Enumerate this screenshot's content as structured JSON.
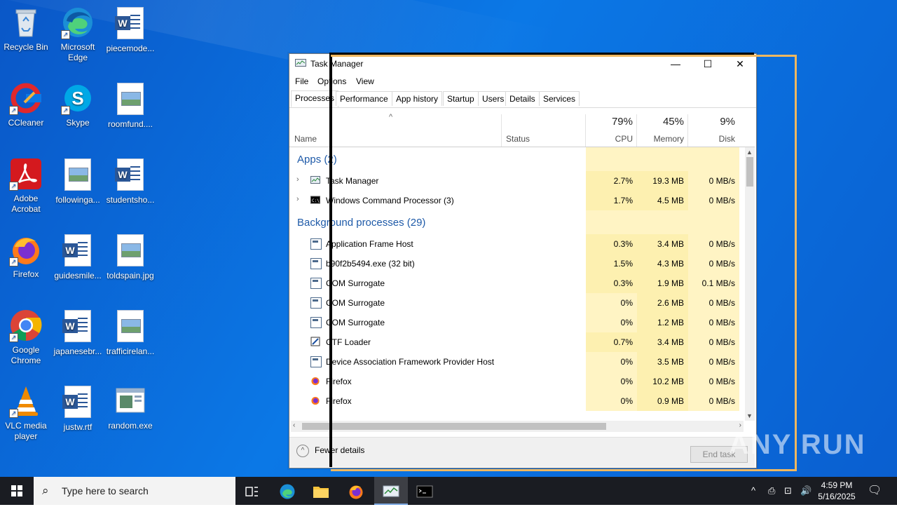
{
  "desktop": {
    "icons": [
      {
        "label": "Recycle Bin"
      },
      {
        "label": "Microsoft Edge"
      },
      {
        "label": "piecemode..."
      },
      {
        "label": "CCleaner"
      },
      {
        "label": "Skype"
      },
      {
        "label": "roomfund...."
      },
      {
        "label": "Adobe Acrobat"
      },
      {
        "label": "followinga..."
      },
      {
        "label": "studentsho..."
      },
      {
        "label": "Firefox"
      },
      {
        "label": "guidesmile..."
      },
      {
        "label": "toldspain.jpg"
      },
      {
        "label": "Google Chrome"
      },
      {
        "label": "japanesebr..."
      },
      {
        "label": "trafficirelan..."
      },
      {
        "label": "VLC media player"
      },
      {
        "label": "justw.rtf"
      },
      {
        "label": "random.exe"
      }
    ]
  },
  "window": {
    "title": "Task Manager",
    "menu": [
      "File",
      "Options",
      "View"
    ],
    "tabs": [
      "Processes",
      "Performance",
      "App history",
      "Startup",
      "Users",
      "Details",
      "Services"
    ],
    "columns": {
      "name": "Name",
      "status": "Status",
      "cpu_pct": "79%",
      "cpu": "CPU",
      "mem_pct": "45%",
      "mem": "Memory",
      "disk_pct": "9%",
      "disk": "Disk"
    },
    "groups": {
      "apps": "Apps (2)",
      "background": "Background processes (29)"
    },
    "apps": [
      {
        "name": "Task Manager",
        "cpu": "2.7%",
        "mem": "19.3 MB",
        "disk": "0 MB/s"
      },
      {
        "name": "Windows Command Processor (3)",
        "cpu": "1.7%",
        "mem": "4.5 MB",
        "disk": "0 MB/s"
      }
    ],
    "background": [
      {
        "name": "Application Frame Host",
        "cpu": "0.3%",
        "mem": "3.4 MB",
        "disk": "0 MB/s"
      },
      {
        "name": "b90f2b5494.exe (32 bit)",
        "cpu": "1.5%",
        "mem": "4.3 MB",
        "disk": "0 MB/s"
      },
      {
        "name": "COM Surrogate",
        "cpu": "0.3%",
        "mem": "1.9 MB",
        "disk": "0.1 MB/s"
      },
      {
        "name": "COM Surrogate",
        "cpu": "0%",
        "mem": "2.6 MB",
        "disk": "0 MB/s"
      },
      {
        "name": "COM Surrogate",
        "cpu": "0%",
        "mem": "1.2 MB",
        "disk": "0 MB/s"
      },
      {
        "name": "CTF Loader",
        "cpu": "0.7%",
        "mem": "3.4 MB",
        "disk": "0 MB/s"
      },
      {
        "name": "Device Association Framework Provider Host",
        "cpu": "0%",
        "mem": "3.5 MB",
        "disk": "0 MB/s"
      },
      {
        "name": "Firefox",
        "cpu": "0%",
        "mem": "10.2 MB",
        "disk": "0 MB/s"
      },
      {
        "name": "Firefox",
        "cpu": "0%",
        "mem": "0.9 MB",
        "disk": "0 MB/s"
      }
    ],
    "footer": {
      "fewer_details": "Fewer details",
      "end_task": "End task"
    }
  },
  "taskbar": {
    "search_placeholder": "Type here to search",
    "time": "4:59 PM",
    "date": "5/16/2025"
  },
  "watermark": "ANY RUN",
  "colors": {
    "desktop": "#0b78e6",
    "cpu_heat": "#fdf0b0",
    "cpu_heat_light": "#fff4c4",
    "selection_frame": "#f0b860"
  }
}
